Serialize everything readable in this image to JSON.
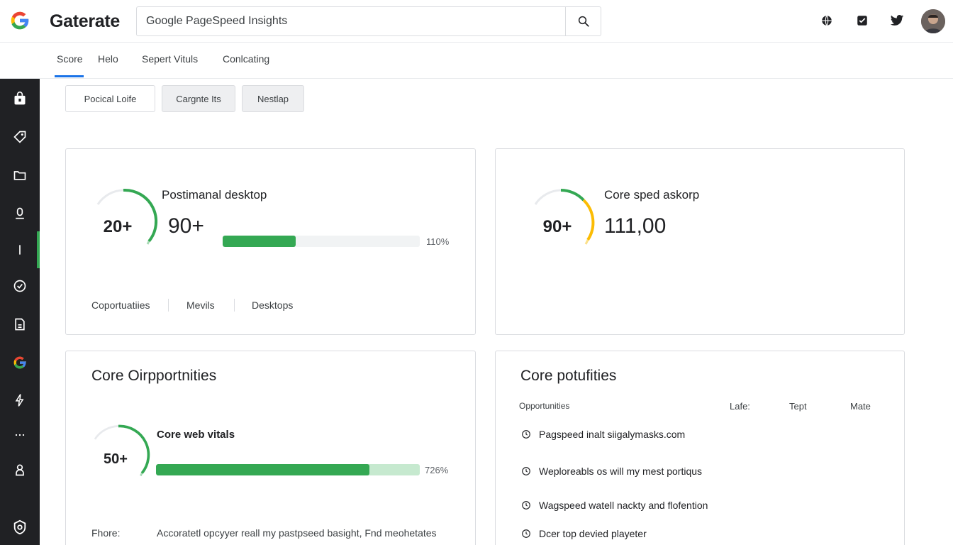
{
  "header": {
    "brand": "Gaterate",
    "search_value": "Google PageSpeed Insights"
  },
  "tabs": [
    {
      "label": "Score",
      "active": true
    },
    {
      "label": "Helo"
    },
    {
      "label": "Sepert Vituls"
    },
    {
      "label": "Conlcating"
    }
  ],
  "filters": [
    {
      "label": "Pocical Loife"
    },
    {
      "label": "Cargnte Its"
    },
    {
      "label": "Nestlap"
    }
  ],
  "card1": {
    "gauge_value": "20+",
    "title": "Postimanal desktop",
    "value": "90+",
    "bar_fraction": 0.37,
    "pct": "110%",
    "tabs": [
      "Coportuatiies",
      "Mevils",
      "Desktops"
    ]
  },
  "card2": {
    "gauge_value": "90+",
    "title": "Core sped askorp",
    "value": "111,00"
  },
  "card3": {
    "title": "Core Oirpportnities",
    "gauge_value": "50+",
    "subtitle": "Core web vitals",
    "bar_fraction": 0.81,
    "pct": "726%",
    "footer_label": "Fhore:",
    "footer_text": "Accoratetl opcyyer reall my pastpseed basight, Fnd meohetates"
  },
  "card4": {
    "title": "Core potufities",
    "columns": [
      "Opportunities",
      "Lafe:",
      "Tept",
      "Mate"
    ],
    "items": [
      "Pagspeed inalt siigalymasks.com",
      "Weploreabls os will my mest portiqus",
      "Wagspeed watell nackty and flofention",
      "Dcer top devied playeter"
    ]
  },
  "colors": {
    "accent_green": "#34a853",
    "light_green": "#a8dab5",
    "accent_yellow": "#fbbc04",
    "sidebar_bg": "#202124",
    "tab_underline": "#1a73e8"
  },
  "icons": {
    "sidebar": [
      "bag-icon",
      "tag-icon",
      "folder-icon",
      "mic-icon",
      "line-icon",
      "check-circle-icon",
      "document-icon",
      "google-icon",
      "bolt-icon",
      "more-icon",
      "person-icon",
      "shield-icon"
    ],
    "top": [
      "globe-icon",
      "checkbox-icon",
      "twitter-icon"
    ]
  }
}
